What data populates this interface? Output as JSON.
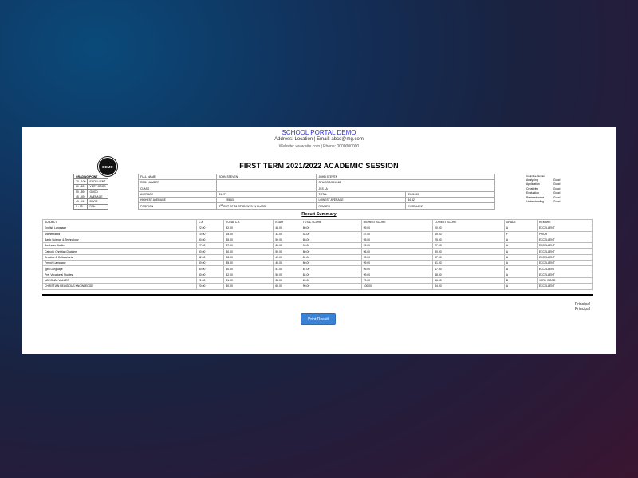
{
  "header": {
    "school_name": "SCHOOL PORTAL DEMO",
    "address": "Address: Location | Email: abcd@mg.com",
    "website": "Website: www.site.com | Phone: 0000000000",
    "logo_text": "DEMO",
    "term_title": "FIRST TERM 2021/2022 ACADEMIC SESSION"
  },
  "grading": {
    "title": "GRADING POINT",
    "rows": [
      [
        "70 - 100",
        "EXCELLENT"
      ],
      [
        "60 - 69",
        "VERY GOOD"
      ],
      [
        "50 - 59",
        "GOOD"
      ],
      [
        "45 - 49",
        "AVERAGE"
      ],
      [
        "40 - 44",
        "POOR"
      ],
      [
        "0 - 39",
        "FAIL"
      ]
    ]
  },
  "student": {
    "full_name_label": "FULL NAME",
    "full_name": "JOHN STEVEN",
    "reg_label": "REG. NUMBER",
    "reg": "STU/SSO/001/118",
    "class_label": "CLASS",
    "class": "JSS 1A",
    "average_label": "AVERAGE",
    "average": "81.27",
    "total_label": "TOTAL",
    "total": "894/1100",
    "highest_avg_label": "HIGHEST AVERAGE",
    "highest_avg": "95.63",
    "lowest_avg_label": "LOWEST AVERAGE",
    "lowest_avg": "34.82",
    "position_label": "POSITION",
    "position_num": "2",
    "position_sup": "nd",
    "position_rest": "OUT OF 31 STUDENTS IN CLASS",
    "remark_label": "REMARK",
    "remark": "EXCELLENT"
  },
  "cognitive": {
    "title": "Cognitive Domain",
    "rows": [
      [
        "Analyzing",
        "Good"
      ],
      [
        "Application",
        "Good"
      ],
      [
        "Creativity",
        "Good"
      ],
      [
        "Evaluation",
        "Good"
      ],
      [
        "Remembrance",
        "Good"
      ],
      [
        "Understanding",
        "Good"
      ]
    ]
  },
  "results": {
    "title": "Result Summary",
    "headers": [
      "SUBJECT",
      "C.A",
      "TOTAL C.A",
      "EXAM",
      "TOTAL SCORE",
      "HIGHEST SCORE",
      "LOWEST SCORE",
      "GRADE",
      "REMARK"
    ],
    "rows": [
      [
        "English Language",
        "22.00",
        "32.00",
        "48.00",
        "80.00",
        "99.00",
        "20.00",
        "A",
        "EXCELLENT"
      ],
      [
        "Mathematics",
        "10.00",
        "15.00",
        "33.00",
        "44.00",
        "87.00",
        "10.00",
        "F",
        "POOR"
      ],
      [
        "Basic Science & Technology",
        "30.00",
        "35.00",
        "50.00",
        "85.00",
        "95.00",
        "25.00",
        "A",
        "EXCELLENT"
      ],
      [
        "Business Studies",
        "27.00",
        "37.00",
        "60.00",
        "90.00",
        "99.00",
        "27.00",
        "A",
        "EXCELLENT"
      ],
      [
        "Catholic Christian Doctrine",
        "30.00",
        "30.00",
        "50.00",
        "80.00",
        "96.00",
        "30.00",
        "A",
        "EXCELLENT"
      ],
      [
        "Creative & Cultural Arts",
        "32.00",
        "33.00",
        "49.00",
        "81.00",
        "99.00",
        "37.00",
        "A",
        "EXCELLENT"
      ],
      [
        "French Language",
        "30.00",
        "35.00",
        "40.00",
        "80.00",
        "99.00",
        "41.00",
        "A",
        "EXCELLENT"
      ],
      [
        "Igbo Language",
        "30.00",
        "30.00",
        "51.00",
        "81.00",
        "99.00",
        "17.00",
        "A",
        "EXCELLENT"
      ],
      [
        "Pre- Vocational Studies",
        "30.00",
        "32.00",
        "50.00",
        "84.00",
        "99.00",
        "48.00",
        "A",
        "EXCELLENT"
      ],
      [
        "NATIONAL VALUES",
        "21.00",
        "31.00",
        "38.00",
        "69.00",
        "79.00",
        "16.00",
        "B",
        "VERY GOOD"
      ],
      [
        "CHRISTIAN RELIGIOUS KNOWLEDGE",
        "20.00",
        "30.00",
        "60.00",
        "90.00",
        "100.00",
        "34.00",
        "A",
        "EXCELLENT"
      ]
    ]
  },
  "footer": {
    "principal_1": "Principal",
    "principal_2": "Principal",
    "print_button": "Print Result"
  },
  "colors": {
    "school_name": "#2d2dd8",
    "button": "#3a82d6"
  }
}
